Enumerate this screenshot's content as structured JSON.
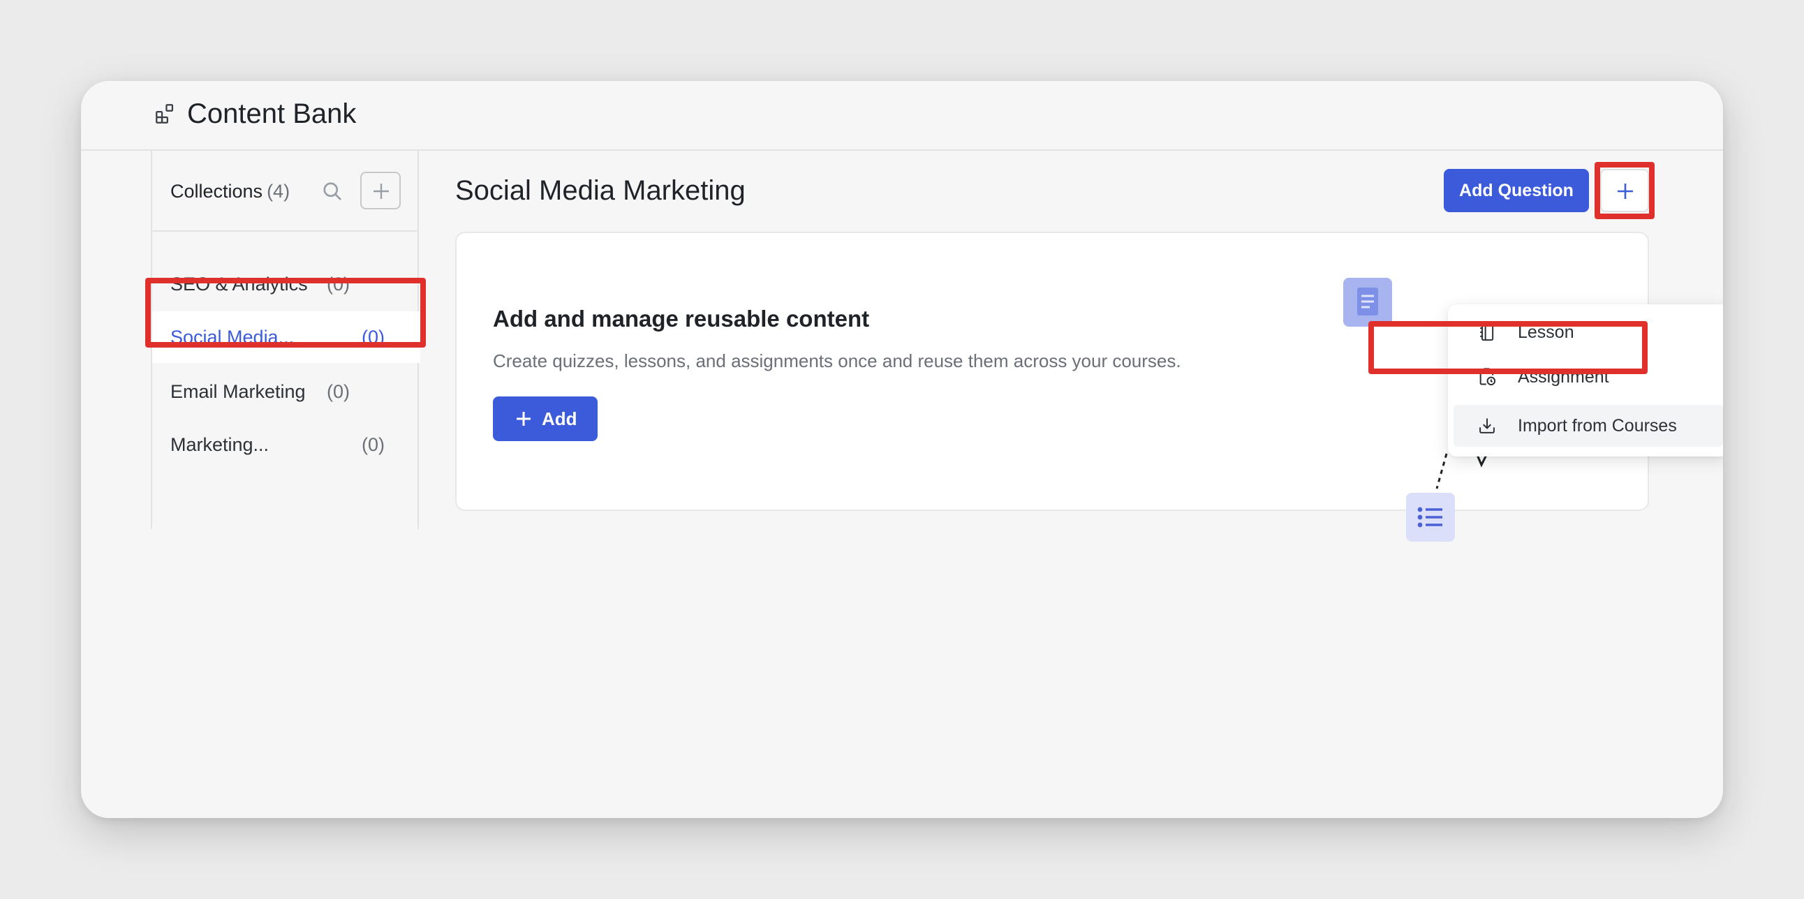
{
  "app": {
    "title": "Content Bank",
    "icon": "grid-blocks-icon"
  },
  "sidebar": {
    "header_label": "Collections",
    "header_count": "(4)",
    "search_icon": "search-icon",
    "add_icon": "plus-icon",
    "items": [
      {
        "name": "SEO & Analytics",
        "count": "(0)",
        "selected": false
      },
      {
        "name": "Social Media...",
        "count": "(0)",
        "selected": true
      },
      {
        "name": "Email Marketing",
        "count": "(0)",
        "selected": false
      },
      {
        "name": "Marketing...",
        "count": "(0)",
        "selected": false
      }
    ]
  },
  "main": {
    "title": "Social Media Marketing",
    "add_question_label": "Add Question",
    "plus_icon": "plus-icon"
  },
  "card": {
    "heading": "Add and manage reusable content",
    "description": "Create quizzes, lessons, and assignments once and reuse them across your courses.",
    "add_label": "Add"
  },
  "dropdown": {
    "items": [
      {
        "label": "Lesson",
        "icon": "notebook-icon"
      },
      {
        "label": "Assignment",
        "icon": "clipboard-clock-icon"
      },
      {
        "label": "Import from Courses",
        "icon": "download-icon",
        "hovered": true
      }
    ]
  },
  "colors": {
    "accent": "#3b5bdb",
    "highlight": "#e0302b",
    "background": "#ebebeb",
    "window": "#f6f6f6"
  }
}
